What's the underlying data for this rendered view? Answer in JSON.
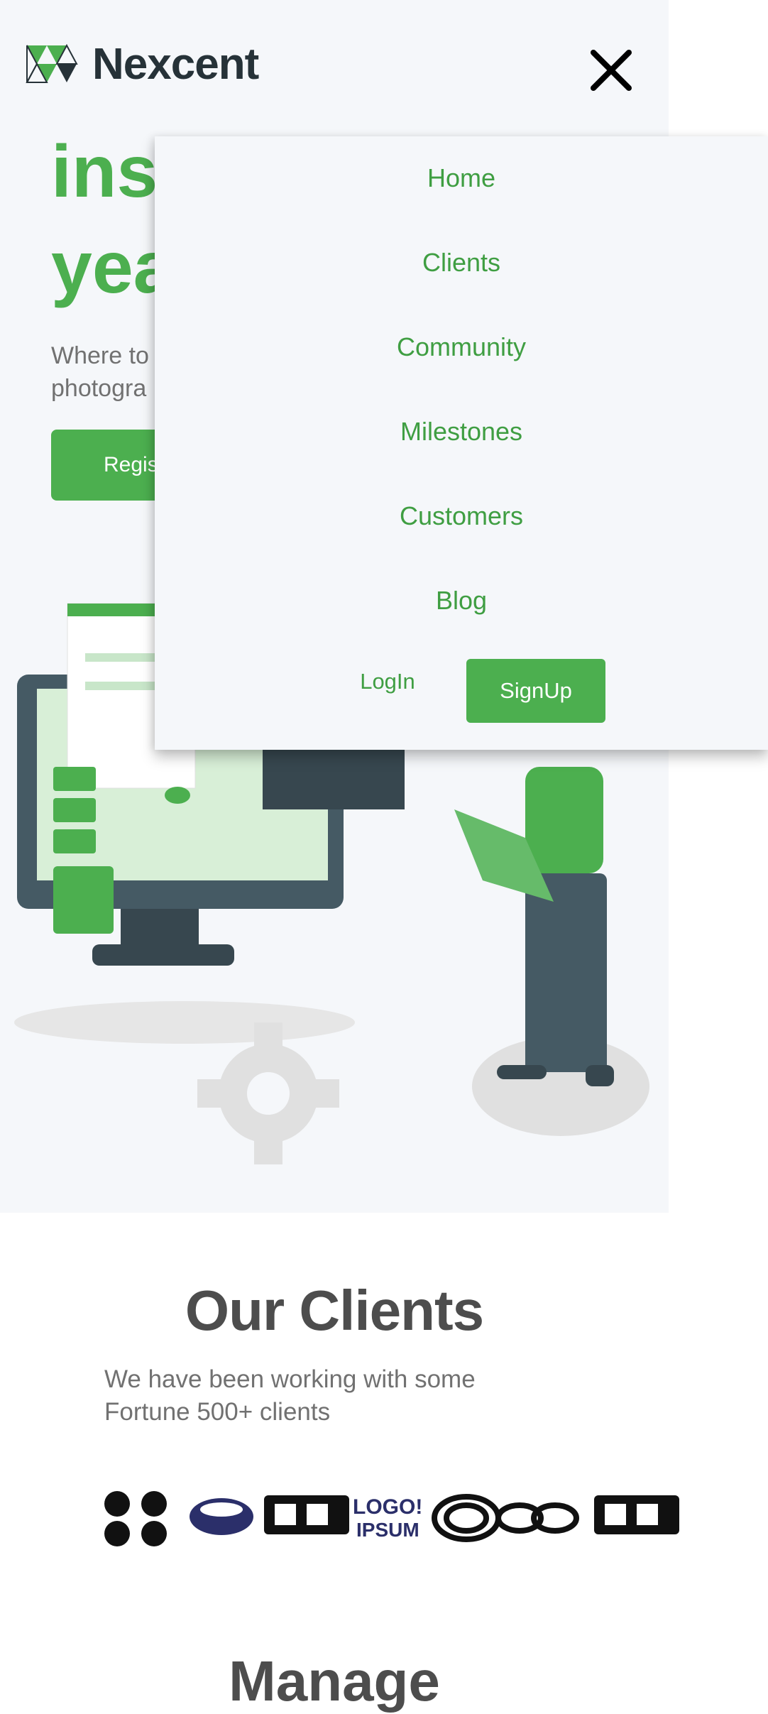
{
  "brand": {
    "name": "Nexcent"
  },
  "hero": {
    "title_line1": "ins",
    "title_line2": "yea",
    "subtitle": "Where to\nphotogra",
    "cta_label": "Regis"
  },
  "menu": {
    "items": [
      "Home",
      "Clients",
      "Community",
      "Milestones",
      "Customers",
      "Blog"
    ],
    "login_label": "LogIn",
    "signup_label": "SignUp"
  },
  "clients": {
    "title": "Our Clients",
    "subtitle": "We have been working with some Fortune 500+ clients",
    "logo_icons": [
      "circle-logo-icon",
      "eye-logo-icon",
      "bold-text-logo-icon",
      "logo-ipsum-icon",
      "rings-logo-icon",
      "infinity-logo-icon",
      "bold-text-logo-icon"
    ]
  },
  "next_section": {
    "title": "Manage"
  },
  "colors": {
    "primary": "#4CAF4F",
    "text_dark": "#4D4D4D",
    "text_grey": "#717171",
    "bg_silver": "#F5F7FA"
  },
  "icons": {
    "close": "close-icon",
    "logo": "nexcent-logo-icon"
  }
}
